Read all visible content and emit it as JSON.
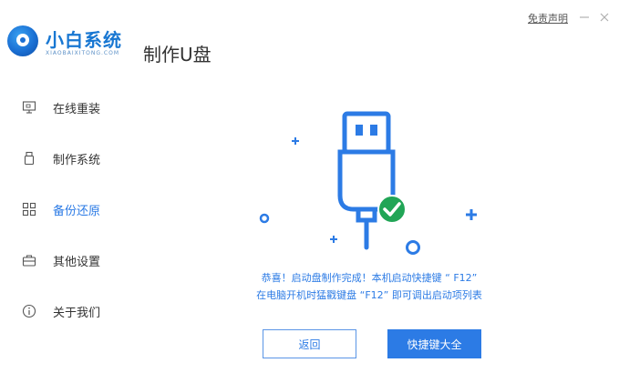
{
  "brand": {
    "name_cn": "小白系统",
    "name_en": "XIAOBAIXITONG.COM"
  },
  "page_title": "制作U盘",
  "top": {
    "disclaimer": "免责声明",
    "minimize": "—",
    "close": "✕"
  },
  "sidebar": {
    "items": [
      {
        "label": "在线重装",
        "icon": "monitor-icon",
        "active": false
      },
      {
        "label": "制作系统",
        "icon": "usb-drive-icon",
        "active": false
      },
      {
        "label": "备份还原",
        "icon": "grid-icon",
        "active": true
      },
      {
        "label": "其他设置",
        "icon": "toolbox-icon",
        "active": false
      },
      {
        "label": "关于我们",
        "icon": "info-icon",
        "active": false
      }
    ]
  },
  "main": {
    "message_line1": "恭喜！启动盘制作完成！本机启动快捷键 “ F12”",
    "message_line2": "在电脑开机时猛戳键盘 “F12” 即可调出启动项列表",
    "back_button": "返回",
    "shortcut_button": "快捷键大全"
  },
  "colors": {
    "accent": "#2c7be5",
    "success": "#21a556",
    "brand": "#1877d2"
  }
}
